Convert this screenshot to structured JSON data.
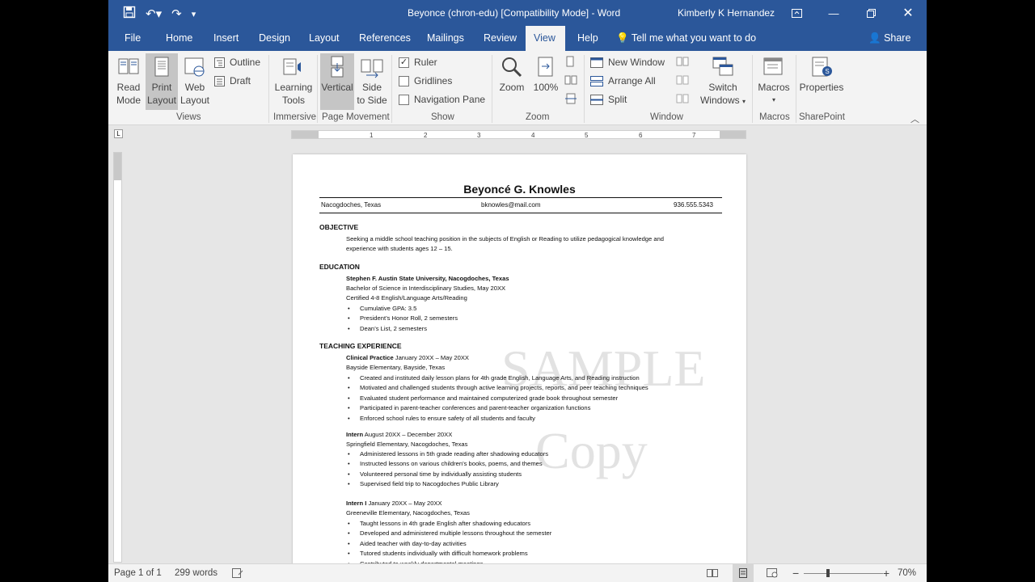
{
  "titlebar": {
    "doc_title": "Beyonce (chron-edu) [Compatibility Mode]  -  Word",
    "user": "Kimberly K Hernandez"
  },
  "tabs": [
    "File",
    "Home",
    "Insert",
    "Design",
    "Layout",
    "References",
    "Mailings",
    "Review",
    "View",
    "Help"
  ],
  "active_tab": "View",
  "tell_me": "Tell me what you want to do",
  "share": "Share",
  "ribbon": {
    "views": {
      "read_mode_1": "Read",
      "read_mode_2": "Mode",
      "print_layout_1": "Print",
      "print_layout_2": "Layout",
      "web_layout_1": "Web",
      "web_layout_2": "Layout",
      "outline": "Outline",
      "draft": "Draft",
      "group": "Views"
    },
    "immersive": {
      "learning_1": "Learning",
      "learning_2": "Tools",
      "group": "Immersive"
    },
    "page_movement": {
      "vertical": "Vertical",
      "side_1": "Side",
      "side_2": "to Side",
      "group": "Page Movement"
    },
    "show": {
      "ruler": "Ruler",
      "gridlines": "Gridlines",
      "nav_pane": "Navigation Pane",
      "group": "Show",
      "ruler_checked": true
    },
    "zoom": {
      "zoom": "Zoom",
      "hundred": "100%",
      "group": "Zoom"
    },
    "window": {
      "new_window": "New Window",
      "arrange_all": "Arrange All",
      "split": "Split",
      "switch_1": "Switch",
      "switch_2": "Windows",
      "group": "Window"
    },
    "macros": {
      "label": "Macros",
      "group": "Macros"
    },
    "sharepoint": {
      "label": "Properties",
      "group": "SharePoint"
    }
  },
  "document": {
    "name": "Beyoncé G. Knowles",
    "city": "Nacogdoches, Texas",
    "email": "bknowles@mail.com",
    "phone": "936.555.5343",
    "objective_head": "OBJECTIVE",
    "objective_1": "Seeking a middle school teaching position in the subjects of English or Reading to utilize pedagogical knowledge and",
    "objective_2": "experience with students ages 12 – 15.",
    "education_head": "EDUCATION",
    "school": "Stephen F. Austin State University, Nacogdoches, Texas",
    "degree": "Bachelor of Science in Interdisciplinary Studies, May 20XX",
    "cert": "Certified 4-8 English/Language Arts/Reading",
    "edu_bullets": [
      "Cumulative GPA: 3.5",
      "President’s Honor Roll, 2 semesters",
      "Dean’s List, 2 semesters"
    ],
    "teaching_head": "TEACHING EXPERIENCE",
    "job1_title": "Clinical Practice",
    "job1_dates": " January 20XX – May 20XX",
    "job1_place": "Bayside Elementary, Bayside, Texas",
    "job1_bullets": [
      "Created and instituted daily lesson plans for 4th grade English, Language Arts, and Reading instruction",
      "Motivated and challenged students through active learning projects, reports, and peer teaching techniques",
      "Evaluated student performance and maintained computerized grade book throughout semester",
      "Participated in parent-teacher conferences and parent-teacher organization functions",
      "Enforced school rules to ensure safety of all students and faculty"
    ],
    "job2_title": "Intern",
    "job2_dates": " August 20XX – December 20XX",
    "job2_place": "Springfield Elementary, Nacogdoches, Texas",
    "job2_bullets": [
      "Administered lessons in 5th grade reading after shadowing educators",
      "Instructed lessons on various children’s books, poems, and themes",
      "Volunteered personal time by individually assisting students",
      "Supervised field trip to Nacogdoches Public Library"
    ],
    "job3_title": "Intern I",
    "job3_dates": " January 20XX – May 20XX",
    "job3_place": "Greeneville Elementary, Nacogdoches, Texas",
    "job3_bullets": [
      "Taught lessons in 4th grade English after shadowing educators",
      "Developed and administered multiple lessons throughout the semester",
      "Aided teacher with day-to-day activities",
      "Tutored students individually with difficult homework problems",
      "Contributed to weekly departmental meetings"
    ],
    "watermark_1": "SAMPLE",
    "watermark_2": "Copy"
  },
  "status": {
    "page": "Page 1 of 1",
    "words": "299 words",
    "zoom": "70%"
  },
  "colors": {
    "accent": "#2b579a",
    "ribbon_bg": "#f3f3f3",
    "canvas": "#e6e6e6"
  }
}
